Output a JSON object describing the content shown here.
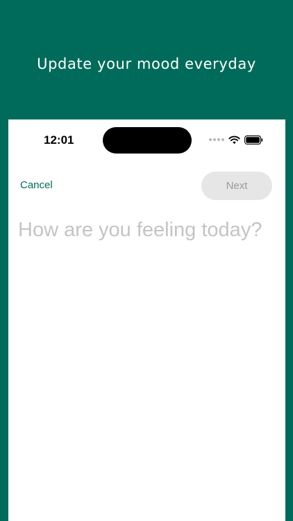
{
  "headline": "Update your mood everyday",
  "status_bar": {
    "time": "12:01",
    "icons": [
      "signal-dots-icon",
      "wifi-icon",
      "battery-icon"
    ]
  },
  "toolbar": {
    "cancel_label": "Cancel",
    "next_label": "Next"
  },
  "mood_input": {
    "placeholder": "How are you feeling today?",
    "value": ""
  },
  "colors": {
    "brand": "#006b5a",
    "placeholder": "#c4c4c7",
    "disabled_button_bg": "#e6e6e6",
    "disabled_button_text": "#9a9a9a"
  }
}
